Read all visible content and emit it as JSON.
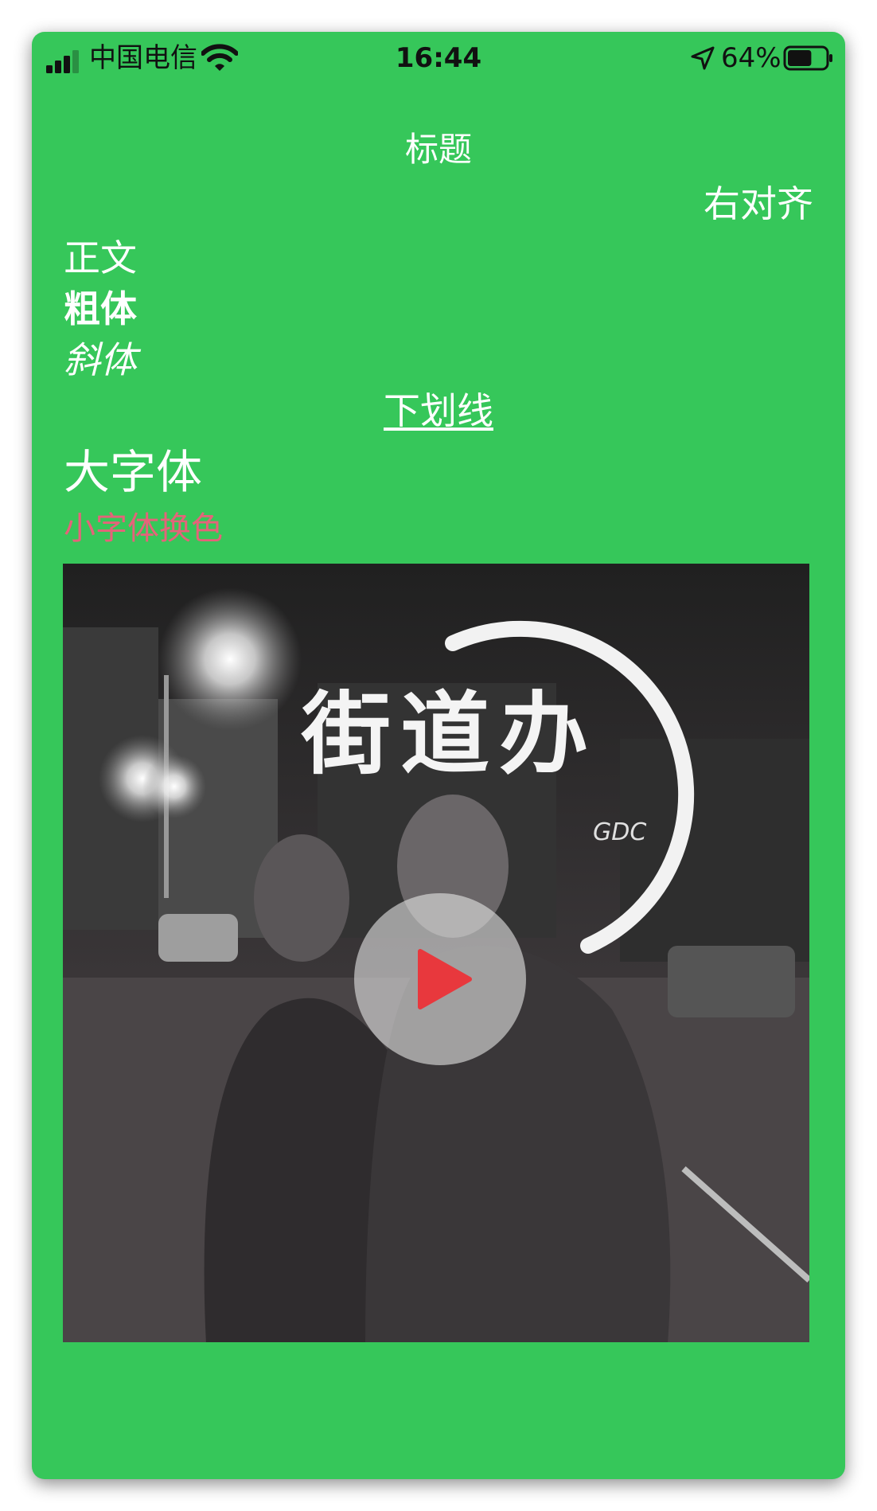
{
  "status_bar": {
    "carrier": "中国电信",
    "time": "16:44",
    "battery": "64%",
    "battery_level": 0.64
  },
  "content": {
    "title": "标题",
    "right_aligned": "右对齐",
    "body": "正文",
    "bold": "粗体",
    "italic": "斜体",
    "underline": "下划线",
    "large": "大字体",
    "small_colored": "小字体换色"
  },
  "video": {
    "cover_title": "街道办",
    "cover_subtitle": "GDC",
    "play_icon": "play-icon"
  },
  "colors": {
    "background": "#36c75a",
    "text": "#ffffff",
    "small_colored_text": "#e5637a",
    "play_icon": "#e8383d"
  }
}
